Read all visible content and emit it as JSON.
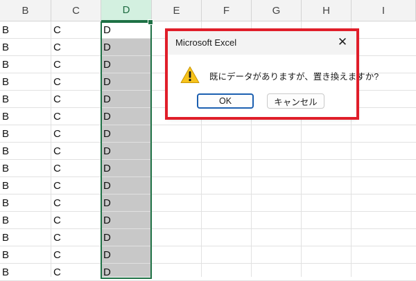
{
  "sheet": {
    "columns": [
      "B",
      "C",
      "D",
      "E",
      "F",
      "G",
      "H",
      "I"
    ],
    "selected_column": "D",
    "rows": [
      [
        "B",
        "C",
        "D"
      ],
      [
        "B",
        "C",
        "D"
      ],
      [
        "B",
        "C",
        "D"
      ],
      [
        "B",
        "C",
        "D"
      ],
      [
        "B",
        "C",
        "D"
      ],
      [
        "B",
        "C",
        "D"
      ],
      [
        "B",
        "C",
        "D"
      ],
      [
        "B",
        "C",
        "D"
      ],
      [
        "B",
        "C",
        "D"
      ],
      [
        "B",
        "C",
        "D"
      ],
      [
        "B",
        "C",
        "D"
      ],
      [
        "B",
        "C",
        "D"
      ],
      [
        "B",
        "C",
        "D"
      ],
      [
        "B",
        "C",
        "D"
      ],
      [
        "B",
        "C",
        "D"
      ]
    ]
  },
  "dialog": {
    "title": "Microsoft Excel",
    "message": "既にデータがありますが、置き換えますか?",
    "ok_label": "OK",
    "cancel_label": "キャンセル",
    "icon": "warning-icon",
    "highlight_color": "#e01e2a"
  },
  "colors": {
    "selection_border": "#1e7145",
    "selection_fill": "#c8c8c8",
    "header_selected": "#d3f0e0"
  }
}
